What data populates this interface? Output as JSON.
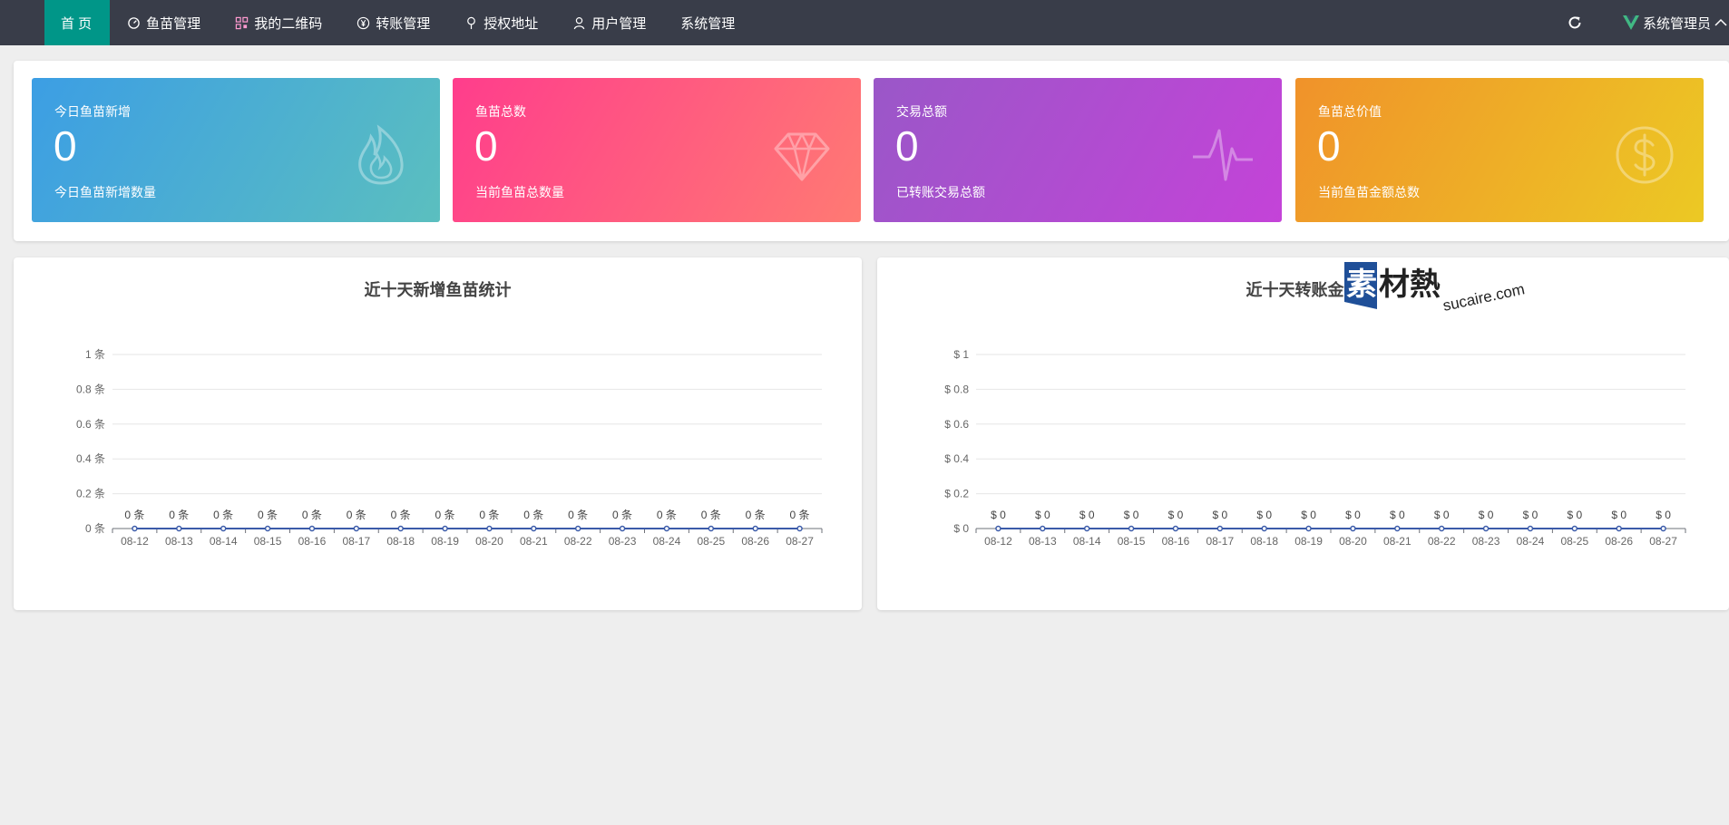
{
  "nav": {
    "items": [
      {
        "label": "首 页",
        "icon": ""
      },
      {
        "label": "鱼苗管理",
        "icon": "fish-icon"
      },
      {
        "label": "我的二维码",
        "icon": "qrcode-icon"
      },
      {
        "label": "转账管理",
        "icon": "yen-icon"
      },
      {
        "label": "授权地址",
        "icon": "location-icon"
      },
      {
        "label": "用户管理",
        "icon": "user-icon"
      },
      {
        "label": "系统管理",
        "icon": ""
      }
    ],
    "user_label": "系统管理员"
  },
  "stats": [
    {
      "title": "今日鱼苗新增",
      "value": "0",
      "desc": "今日鱼苗新增数量",
      "icon": "fire-icon"
    },
    {
      "title": "鱼苗总数",
      "value": "0",
      "desc": "当前鱼苗总数量",
      "icon": "diamond-icon"
    },
    {
      "title": "交易总额",
      "value": "0",
      "desc": "已转账交易总额",
      "icon": "pulse-icon"
    },
    {
      "title": "鱼苗总价值",
      "value": "0",
      "desc": "当前鱼苗金额总数",
      "icon": "dollar-icon"
    }
  ],
  "watermark": {
    "brand": "素材熱",
    "site": "sucaire.com"
  },
  "chart_data": [
    {
      "type": "line",
      "title": "近十天新增鱼苗统计",
      "categories": [
        "08-12",
        "08-13",
        "08-14",
        "08-15",
        "08-16",
        "08-17",
        "08-18",
        "08-19",
        "08-20",
        "08-21",
        "08-22",
        "08-23",
        "08-24",
        "08-25",
        "08-26",
        "08-27"
      ],
      "series": [
        {
          "values": [
            0,
            0,
            0,
            0,
            0,
            0,
            0,
            0,
            0,
            0,
            0,
            0,
            0,
            0,
            0,
            0
          ]
        }
      ],
      "ylim": [
        0,
        1
      ],
      "yticks": [
        0,
        0.2,
        0.4,
        0.6,
        0.8,
        1
      ],
      "y_prefix": "",
      "y_suffix": " 条",
      "line_color": "#3b5ba9",
      "grid": true
    },
    {
      "type": "line",
      "title": "近十天转账金额",
      "categories": [
        "08-12",
        "08-13",
        "08-14",
        "08-15",
        "08-16",
        "08-17",
        "08-18",
        "08-19",
        "08-20",
        "08-21",
        "08-22",
        "08-23",
        "08-24",
        "08-25",
        "08-26",
        "08-27"
      ],
      "series": [
        {
          "values": [
            0,
            0,
            0,
            0,
            0,
            0,
            0,
            0,
            0,
            0,
            0,
            0,
            0,
            0,
            0,
            0
          ]
        }
      ],
      "ylim": [
        0,
        1
      ],
      "yticks": [
        0,
        0.2,
        0.4,
        0.6,
        0.8,
        1
      ],
      "y_prefix": "$ ",
      "y_suffix": "",
      "line_color": "#3b5ba9",
      "grid": true
    }
  ]
}
